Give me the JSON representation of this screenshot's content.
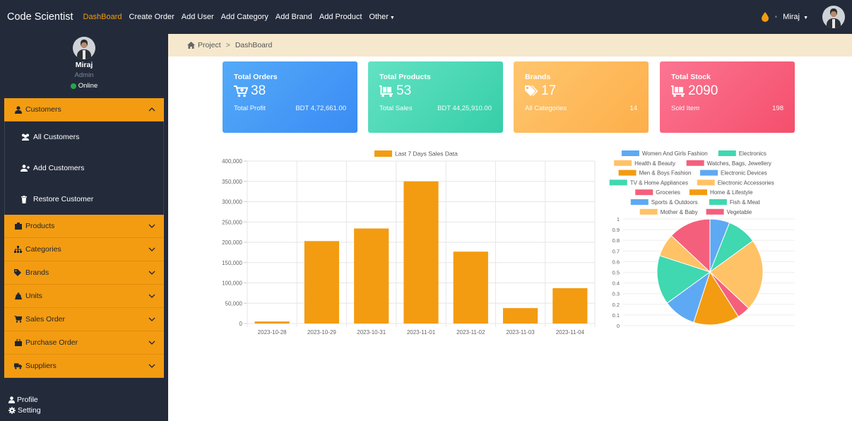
{
  "topbar": {
    "brand": "Code Scientist",
    "nav": [
      {
        "label": "DashBoard",
        "active": true
      },
      {
        "label": "Create Order"
      },
      {
        "label": "Add User"
      },
      {
        "label": "Add Category"
      },
      {
        "label": "Add Brand"
      },
      {
        "label": "Add Product"
      },
      {
        "label": "Other",
        "caret": true
      }
    ],
    "user": "Miraj",
    "accent": "#f39c12"
  },
  "sidebar": {
    "profile": {
      "name": "Miraj",
      "role": "Admin",
      "status": "Online"
    },
    "menu": [
      {
        "label": "Customers",
        "icon": "user-icon",
        "expanded": true,
        "sub": [
          {
            "label": "All Customers",
            "icon": "users-icon"
          },
          {
            "label": "Add Customers",
            "icon": "user-plus-icon"
          },
          {
            "label": "Restore Customer",
            "icon": "trash-icon"
          }
        ]
      },
      {
        "label": "Products",
        "icon": "box-icon"
      },
      {
        "label": "Categories",
        "icon": "sitemap-icon"
      },
      {
        "label": "Brands",
        "icon": "tags-icon"
      },
      {
        "label": "Units",
        "icon": "weight-icon"
      },
      {
        "label": "Sales Order",
        "icon": "cart-icon"
      },
      {
        "label": "Purchase Order",
        "icon": "bag-icon"
      },
      {
        "label": "Suppliers",
        "icon": "truck-icon"
      }
    ],
    "footer": [
      {
        "label": "Profile",
        "icon": "user-icon"
      },
      {
        "label": "Setting",
        "icon": "gear-icon"
      }
    ]
  },
  "breadcrumb": {
    "items": [
      "Project",
      "DashBoard"
    ],
    "separator": ">"
  },
  "cards": [
    {
      "title": "Total Orders",
      "value": "38",
      "icon": "cart-plus-icon",
      "foot_label": "Total Profit",
      "foot_value": "BDT 4,72,661.00",
      "color_from": "#4ea3f8",
      "color_to": "#3d8ef5"
    },
    {
      "title": "Total Products",
      "value": "53",
      "icon": "cart-flatbed-icon",
      "foot_label": "Total Sales",
      "foot_value": "BDT 44,25,910.00",
      "color_from": "#5fe0c1",
      "color_to": "#37cfa9"
    },
    {
      "title": "Brands",
      "value": "17",
      "icon": "tags-icon",
      "foot_label": "All Categories",
      "foot_value": "14",
      "color_from": "#ffc266",
      "color_to": "#fdb04d"
    },
    {
      "title": "Total Stock",
      "value": "2090",
      "icon": "cart-flatbed-icon",
      "foot_label": "Sold Item",
      "foot_value": "198",
      "color_from": "#fb6f8d",
      "color_to": "#f5506d"
    }
  ],
  "chart_data": [
    {
      "type": "bar",
      "title": "",
      "categories": [
        "2023-10-28",
        "2023-10-29",
        "2023-10-31",
        "2023-11-01",
        "2023-11-02",
        "2023-11-03",
        "2023-11-04"
      ],
      "series": [
        {
          "name": "Last 7 Days Sales Data",
          "values": [
            5000,
            203000,
            234000,
            350000,
            177000,
            38000,
            87000
          ],
          "color": "#f39c12"
        }
      ],
      "ylim": [
        0,
        400000
      ],
      "yticks": [
        "400,000",
        "350,000",
        "300,000",
        "250,000",
        "200,000",
        "150,000",
        "100,000",
        "50,000",
        "0"
      ],
      "grid": true,
      "legend": "top"
    },
    {
      "type": "pie",
      "labels": [
        "Women And Girls Fashion",
        "Electronics",
        "Health & Beauty",
        "Watches, Bags, Jewellery",
        "Men & Boys Fashion",
        "Electronic Devices",
        "TV & Home Appliances",
        "Electronic Accessories",
        "Groceries",
        "Home & Lifestyle",
        "Sports & Outdoors",
        "Fish & Meat",
        "Mother & Baby",
        "Vegetable"
      ],
      "colors": [
        "#5ea9f3",
        "#3fd8b0",
        "#ffc266",
        "#f4607c",
        "#f39c12",
        "#5ea9f3",
        "#3fd8b0",
        "#ffc266",
        "#f4607c",
        "#f39c12",
        "#5ea9f3",
        "#3fd8b0",
        "#ffc266",
        "#f4607c"
      ],
      "slices": [
        {
          "label": "Women And Girls Fashion",
          "value": 0.06,
          "color": "#5ea9f3"
        },
        {
          "label": "Electronics",
          "value": 0.09,
          "color": "#3fd8b0"
        },
        {
          "label": "Health & Beauty",
          "value": 0.22,
          "color": "#ffc266"
        },
        {
          "label": "Watches, Bags, Jewellery",
          "value": 0.04,
          "color": "#f4607c"
        },
        {
          "label": "Men & Boys Fashion",
          "value": 0.14,
          "color": "#f39c12"
        },
        {
          "label": "Electronic Devices",
          "value": 0.1,
          "color": "#5ea9f3"
        },
        {
          "label": "TV & Home Appliances",
          "value": 0.15,
          "color": "#3fd8b0"
        },
        {
          "label": "Electronic Accessories",
          "value": 0.07,
          "color": "#ffc266"
        },
        {
          "label": "Groceries",
          "value": 0.13,
          "color": "#f4607c"
        }
      ],
      "yticks": [
        "1",
        "0.9",
        "0.8",
        "0.7",
        "0.6",
        "0.5",
        "0.4",
        "0.3",
        "0.2",
        "0.1",
        "0"
      ],
      "legend": "top"
    }
  ]
}
